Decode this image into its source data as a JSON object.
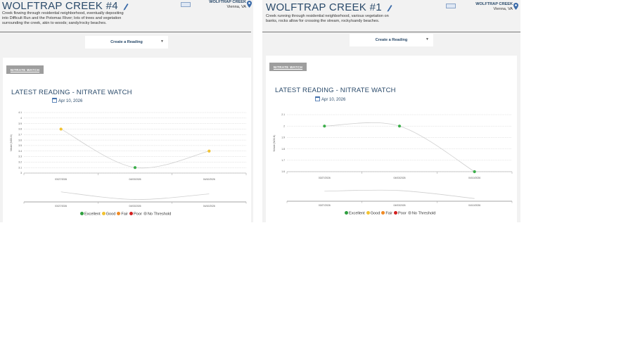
{
  "panels": [
    {
      "title": "WOLFTRAP CREEK #4",
      "description": "Creek flowing through residential neighborhood, eventually depositing into Difficult Run and the Potomac River; lots of trees and vegetation surrounding the creek, akin to woods; sandy/rocky beaches.",
      "location_name": "WOLFTRAP CREEK",
      "location_city": "Vienna, VA",
      "create_label": "Create a Reading",
      "tab_label": "NITRATE WATCH",
      "chart_title": "LATEST READING - NITRATE WATCH",
      "chart_date": "Apr 10, 2026",
      "icons": [
        "pencil-icon",
        "flag-icon",
        "map-pin-icon",
        "chevron-down-icon",
        "calendar-icon"
      ],
      "chart_data": {
        "type": "line",
        "x": [
          "03/27/2026",
          "04/03/2026",
          "04/10/2026"
        ],
        "series": [
          {
            "values": [
              3.8,
              3.1,
              3.4
            ],
            "colors": [
              "#f2c230",
              "#3cae4a",
              "#f2c230"
            ]
          }
        ],
        "ylabel": "Nitrate (NO3-N)",
        "yticks": [
          3,
          3.1,
          3.2,
          3.3,
          3.4,
          3.5,
          3.6,
          3.7,
          3.8,
          3.9,
          4,
          4.1
        ],
        "ylim": [
          3,
          4.1
        ],
        "grid": true
      },
      "navigator_x": [
        "03/27/2026",
        "04/03/2026",
        "04/10/2026"
      ],
      "navigator_y": [
        0.25,
        0.82,
        0.4
      ]
    },
    {
      "title": "WOLFTRAP CREEK #1",
      "description": "Creek running through residential neighborhood, various vegetation on banks, rocks allow for crossing the stream, rocky/sandy beaches.",
      "location_name": "WOLFTRAP CREEK",
      "location_city": "Vienna, VA",
      "create_label": "Create a Reading",
      "tab_label": "NITRATE WATCH",
      "chart_title": "LATEST READING - NITRATE WATCH",
      "chart_date": "Apr 10, 2026",
      "icons": [
        "pencil-icon",
        "flag-icon",
        "map-pin-icon",
        "chevron-down-icon",
        "calendar-icon"
      ],
      "chart_data": {
        "type": "line",
        "x": [
          "03/27/2026",
          "04/03/2026",
          "04/10/2026"
        ],
        "series": [
          {
            "values": [
              2,
              2,
              1.6
            ],
            "colors": [
              "#3cae4a",
              "#3cae4a",
              "#3cae4a"
            ]
          }
        ],
        "ylabel": "Nitrate (NO3-N)",
        "yticks": [
          1.6,
          1.7,
          1.8,
          1.9,
          2,
          2.1
        ],
        "ylim": [
          1.6,
          2.1
        ],
        "grid": true
      },
      "navigator_x": [
        "03/27/2026",
        "04/03/2026",
        "04/10/2026"
      ],
      "navigator_y": [
        0.25,
        0.2,
        0.8
      ]
    }
  ],
  "legend": [
    {
      "label": "Excellent",
      "color": "#2e9e3e"
    },
    {
      "label": "Good",
      "color": "#f2c230"
    },
    {
      "label": "Fair",
      "color": "#f08a24"
    },
    {
      "label": "Poor",
      "color": "#d21f1f"
    },
    {
      "label": "No Threshold",
      "color": "#bdbdbd"
    }
  ]
}
